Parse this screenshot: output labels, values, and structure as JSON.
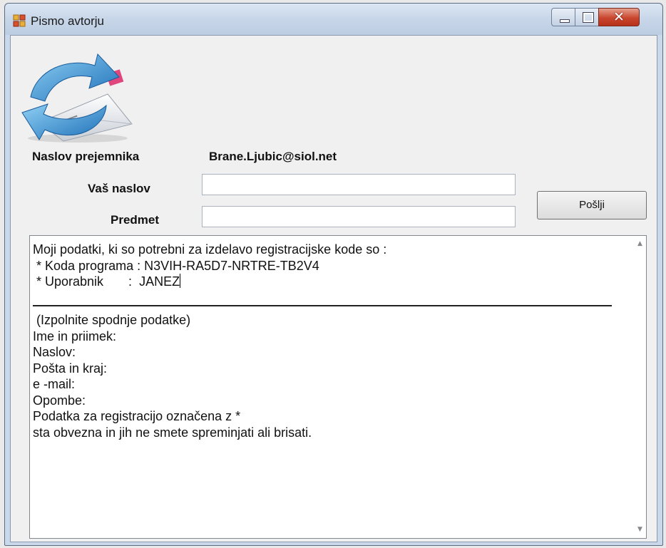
{
  "window": {
    "title": "Pismo avtorju"
  },
  "form": {
    "recipient_label": "Naslov prejemnika",
    "recipient_value": "Brane.Ljubic@siol.net",
    "your_address_label": "Vaš naslov",
    "your_address_value": "",
    "subject_label": "Predmet",
    "subject_value": "",
    "send_label": "Pošlji"
  },
  "message": {
    "upper_lines": [
      "Moji podatki, ki so potrebni za izdelavo registracijske kode so :",
      " * Koda programa : N3VIH-RA5D7-NRTRE-TB2V4",
      " * Uporabnik       :  JANEZ"
    ],
    "lower_lines": [
      " (Izpolnite spodnje podatke)",
      "Ime in priimek:",
      "Naslov:",
      "Pošta in kraj:",
      "e -mail:",
      "Opombe:",
      "Podatka za registracijo označena z *",
      "sta obvezna in jih ne smete spreminjati ali brisati."
    ]
  },
  "colors": {
    "titlebar": "#c7d6e8",
    "close_button": "#c9462e",
    "client_bg": "#f0f0f0"
  },
  "icons": [
    "app-icon",
    "email-refresh-icon",
    "minimize-icon",
    "maximize-icon",
    "close-icon",
    "scroll-up-icon",
    "scroll-down-icon"
  ]
}
